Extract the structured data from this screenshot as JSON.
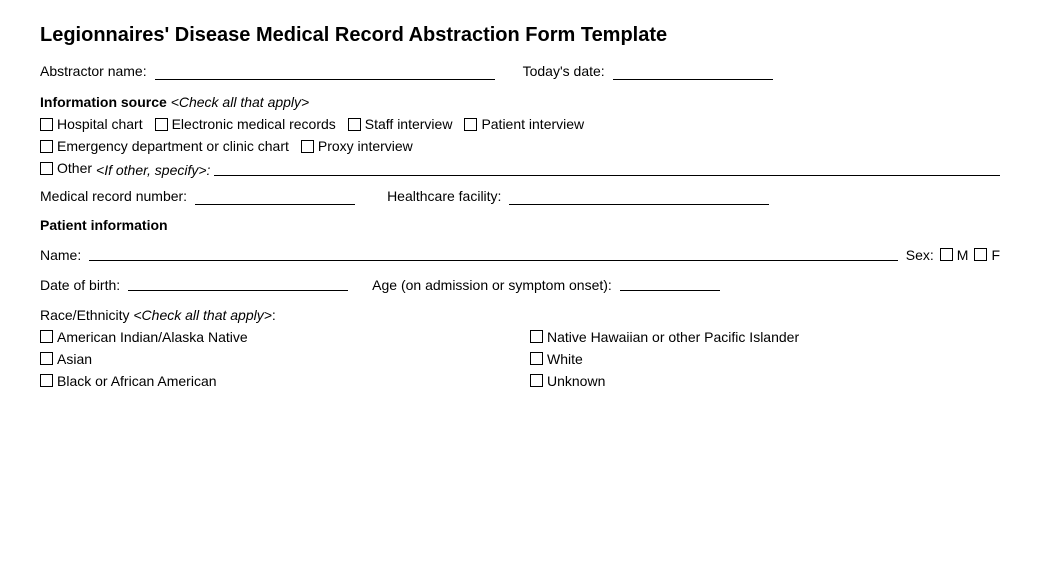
{
  "title": "Legionnaires' Disease Medical Record Abstraction Form Template",
  "abstractor": {
    "label": "Abstractor name:",
    "date_label": "Today's date:"
  },
  "information_source": {
    "label": "Information source",
    "sublabel": "<Check all that apply>",
    "checkboxes_row1": [
      "Hospital chart",
      "Electronic medical records",
      "Staff interview",
      "Patient interview"
    ],
    "checkboxes_row2": [
      "Emergency department or clinic chart",
      "Proxy interview"
    ],
    "other_label": "Other",
    "other_specify": "<If other, specify>:"
  },
  "medical_record": {
    "mrn_label": "Medical record number:",
    "facility_label": "Healthcare facility:"
  },
  "patient_info": {
    "section_label": "Patient information",
    "name_label": "Name:",
    "sex_label": "Sex:",
    "sex_options": [
      "M",
      "F"
    ],
    "dob_label": "Date of birth:",
    "age_label": "Age (on admission or symptom onset):",
    "race_label": "Race/Ethnicity",
    "race_sublabel": "<Check all that apply>:",
    "race_options": [
      [
        "American Indian/Alaska Native",
        "Native Hawaiian or other Pacific Islander"
      ],
      [
        "Asian",
        "White"
      ],
      [
        "Black or African American",
        "Unknown"
      ]
    ]
  }
}
